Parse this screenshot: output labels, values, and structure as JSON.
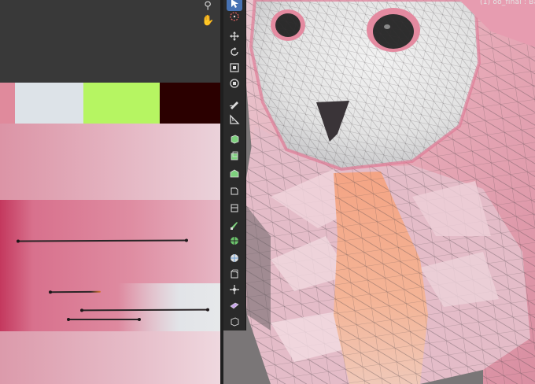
{
  "header": {
    "object_label": "(1) oo_final : Basis"
  },
  "view_controls": [
    {
      "name": "zoom-icon",
      "glyph": "⚲"
    },
    {
      "name": "hand-pan-icon",
      "glyph": "✋"
    }
  ],
  "swatches": [
    {
      "color": "#e08a9c"
    },
    {
      "color": "#dde3e8"
    },
    {
      "color": "#b6f562"
    },
    {
      "color": "#2b0000"
    }
  ],
  "tools": [
    {
      "name": "select-tool-icon",
      "active": true
    },
    {
      "name": "cursor-tool-icon"
    },
    {
      "name": "move-tool-icon"
    },
    {
      "name": "rotate-tool-icon"
    },
    {
      "name": "scale-tool-icon"
    },
    {
      "name": "transform-tool-icon"
    },
    {
      "name": "annotate-tool-icon"
    },
    {
      "name": "measure-tool-icon"
    },
    {
      "name": "add-cube-tool-icon"
    },
    {
      "name": "extrude-tool-icon"
    },
    {
      "name": "inset-tool-icon"
    },
    {
      "name": "bevel-tool-icon"
    },
    {
      "name": "loop-cut-tool-icon"
    },
    {
      "name": "knife-tool-icon"
    },
    {
      "name": "poly-build-tool-icon"
    },
    {
      "name": "spin-tool-icon"
    },
    {
      "name": "smooth-tool-icon"
    },
    {
      "name": "edge-slide-tool-icon"
    },
    {
      "name": "shrink-fatten-tool-icon"
    },
    {
      "name": "shear-tool-icon"
    },
    {
      "name": "rip-region-tool-icon"
    }
  ]
}
